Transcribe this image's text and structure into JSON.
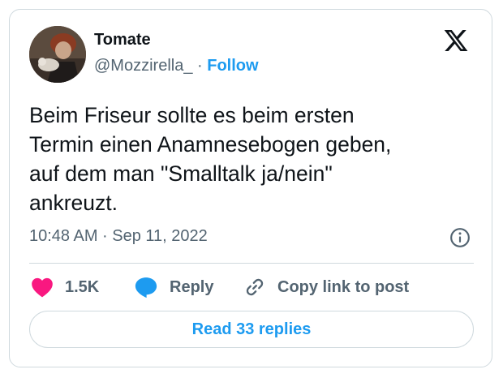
{
  "author": {
    "name": "Tomate",
    "handle": "@Mozzirella_",
    "separator": "·",
    "follow_label": "Follow",
    "avatar_icon": "profile-photo"
  },
  "platform_logo": "x-logo-icon",
  "tweet": {
    "text": "Beim Friseur sollte es beim ersten\nTermin einen Anamnesebogen geben,\nauf dem man \"Smalltalk ja/nein\"\nankreuzt.",
    "timestamp": "10:48 AM · Sep 11, 2022"
  },
  "actions": {
    "like_count": "1.5K",
    "reply_label": "Reply",
    "copy_label": "Copy link to post"
  },
  "read_replies_label": "Read 33 replies",
  "colors": {
    "accent": "#1d9bf0",
    "like": "#f91880",
    "text": "#0f1419",
    "muted": "#536471",
    "border": "#cfd9de"
  }
}
